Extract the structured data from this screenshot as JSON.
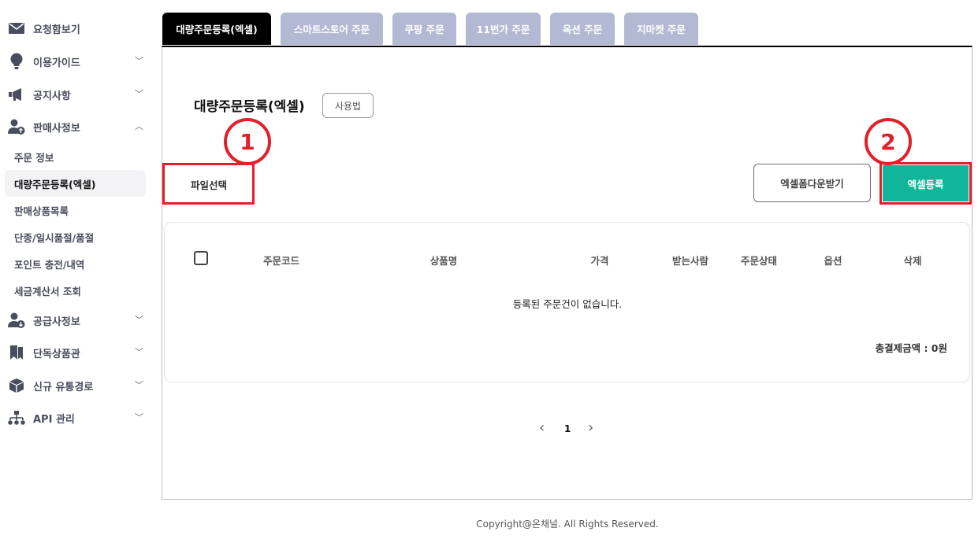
{
  "sidebar": {
    "items": [
      {
        "label": "요청함보기",
        "icon": "envelope-icon"
      },
      {
        "label": "이용가이드",
        "icon": "lightbulb-icon"
      },
      {
        "label": "공지사항",
        "icon": "megaphone-icon"
      },
      {
        "label": "판매사정보",
        "icon": "user-upload-icon"
      },
      {
        "label": "공급사정보",
        "icon": "user-download-icon"
      },
      {
        "label": "단독상품관",
        "icon": "bookmark-icon"
      },
      {
        "label": "신규 유통경로",
        "icon": "box-icon"
      },
      {
        "label": "API 관리",
        "icon": "network-icon"
      }
    ],
    "sub_items": [
      {
        "label": "주문 정보"
      },
      {
        "label": "대량주문등록(엑셀)"
      },
      {
        "label": "판매상품목록"
      },
      {
        "label": "단종/일시품절/품절"
      },
      {
        "label": "포인트 충전/내역"
      },
      {
        "label": "세금계산서 조회"
      }
    ]
  },
  "tabs": [
    {
      "label": "대량주문등록(엑셀)"
    },
    {
      "label": "스마트스토어 주문"
    },
    {
      "label": "쿠팡 주문"
    },
    {
      "label": "11번가 주문"
    },
    {
      "label": "옥션 주문"
    },
    {
      "label": "지마켓 주문"
    }
  ],
  "main": {
    "title": "대량주문등록(엑셀)",
    "usage_button": "사용법",
    "file_button": "파일선택",
    "form_download_button": "엑셀폼다운받기",
    "register_button": "엑셀등록",
    "badge_1": "1",
    "badge_2": "2"
  },
  "table": {
    "columns": [
      "주문코드",
      "상품명",
      "가격",
      "받는사람",
      "주문상태",
      "옵션",
      "삭제"
    ],
    "empty_message": "등록된 주문건이 없습니다.",
    "total": "총결제금액 : 0원"
  },
  "pagination": {
    "current": "1",
    "prev": "‹",
    "next": "›"
  },
  "footer": {
    "copyright": "Copyright@온채널. All Rights Reserved."
  },
  "colors": {
    "accent": "#11b59a",
    "highlight": "#e0202a",
    "tab_inactive": "#b3b8d3"
  }
}
